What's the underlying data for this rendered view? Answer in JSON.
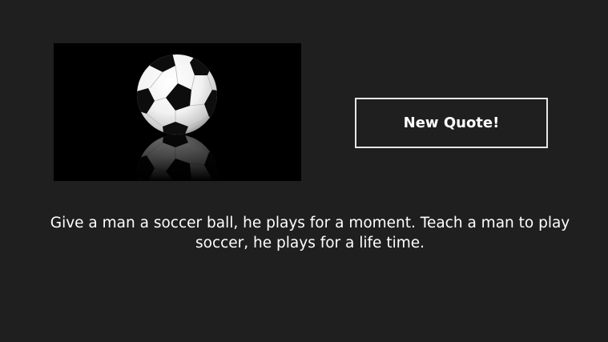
{
  "image": {
    "icon": "soccer-ball-icon"
  },
  "button": {
    "label": "New Quote!"
  },
  "quote": {
    "text": "Give a man a soccer ball, he plays for a moment. Teach a man to play soccer, he plays for a life time."
  },
  "colors": {
    "background": "#1f1f1f",
    "image_background": "#000000",
    "button_border": "#e6e6e6",
    "text": "#ffffff"
  }
}
